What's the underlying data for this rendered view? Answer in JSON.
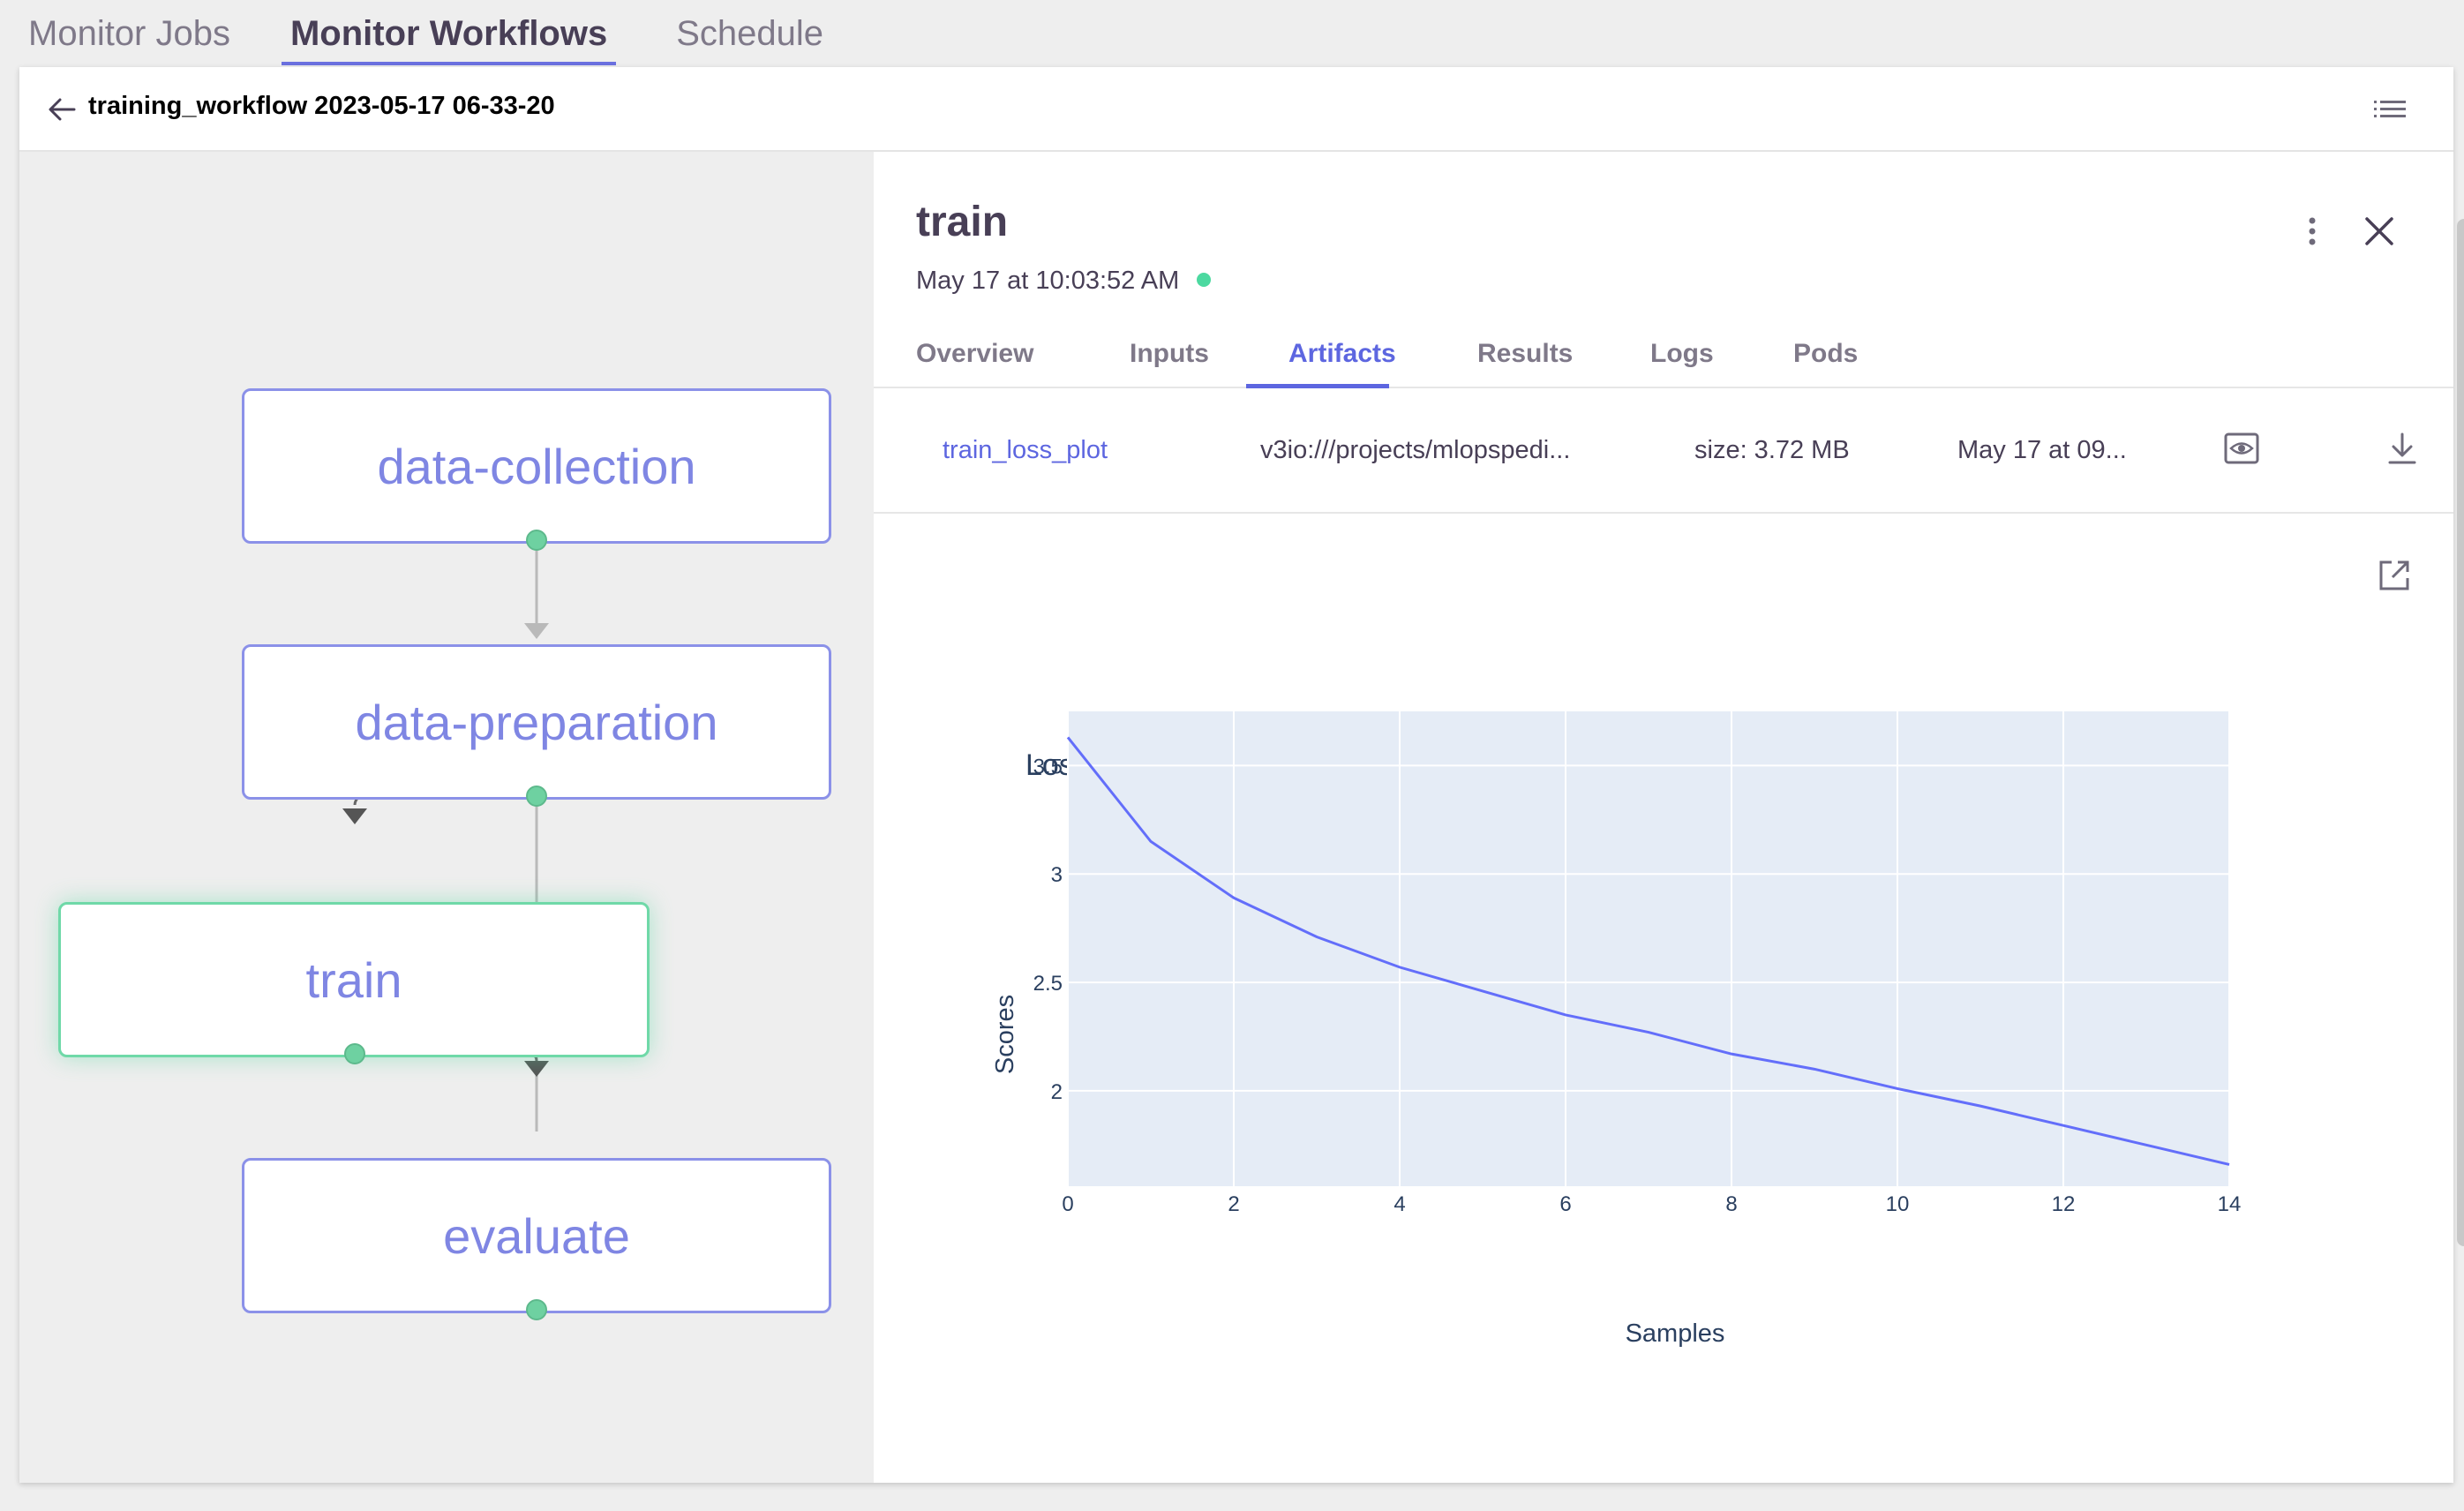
{
  "top_tabs": [
    "Monitor Jobs",
    "Monitor Workflows",
    "Schedule"
  ],
  "workflow": {
    "title": "training_workflow 2023-05-17 06-33-20"
  },
  "graph": {
    "nodes": [
      "data-collection",
      "data-preparation",
      "train",
      "evaluate"
    ],
    "selected": "train"
  },
  "details": {
    "title": "train",
    "date": "May 17 at 10:03:52 AM",
    "status_color": "#4cd9a0",
    "tabs": [
      "Overview",
      "Inputs",
      "Artifacts",
      "Results",
      "Logs",
      "Pods"
    ],
    "active_tab": "Artifacts",
    "artifact": {
      "name": "train_loss_plot",
      "path": "v3io:///projects/mlopspedi...",
      "size": "size: 3.72 MB",
      "date": "May 17 at 09..."
    }
  },
  "icons": {
    "back": "arrow-left-icon",
    "list": "list-icon",
    "kebab": "more-vertical-icon",
    "close": "close-icon",
    "preview": "eye-icon",
    "download": "download-icon",
    "popout": "external-link-icon"
  },
  "accent_color": "#5d66e0",
  "chart_data": {
    "type": "line",
    "title": "Loss",
    "xlabel": "Samples",
    "ylabel": "Scores",
    "x": [
      0,
      1,
      2,
      3,
      4,
      5,
      6,
      7,
      8,
      9,
      10,
      11,
      12,
      13,
      14
    ],
    "values": [
      3.63,
      3.15,
      2.89,
      2.71,
      2.57,
      2.46,
      2.35,
      2.27,
      2.17,
      2.1,
      2.01,
      1.93,
      1.84,
      1.75,
      1.66
    ],
    "xlim": [
      0,
      14
    ],
    "ylim": [
      1.56,
      3.75
    ],
    "xticks": [
      0,
      2,
      4,
      6,
      8,
      10,
      12,
      14
    ],
    "yticks": [
      2,
      2.5,
      3,
      3.5
    ],
    "ytick_labels": [
      "2",
      "2.5",
      "3",
      "3.5"
    ],
    "grid": true,
    "line_color": "#636efa",
    "plot_bgcolor": "#e5ecf6"
  }
}
